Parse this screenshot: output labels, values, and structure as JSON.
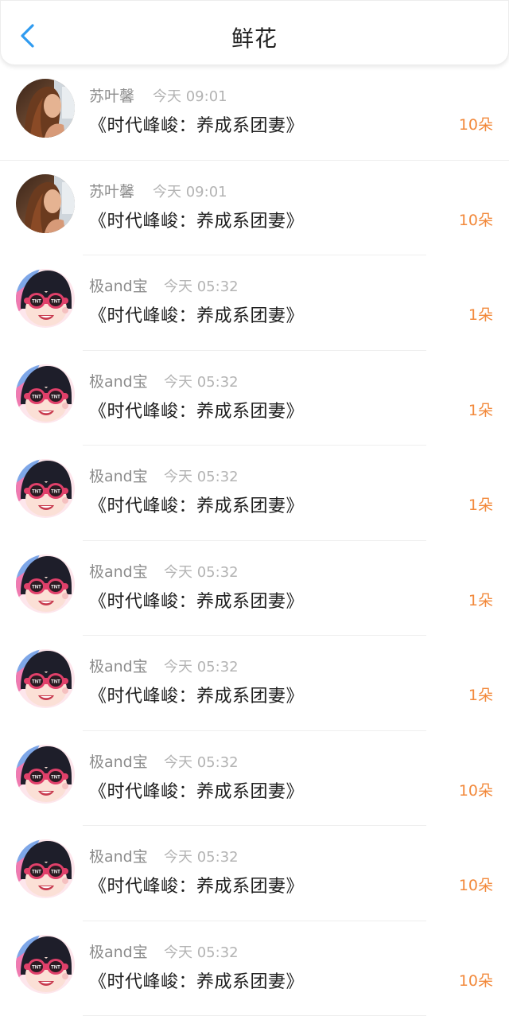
{
  "header": {
    "title": "鲜花",
    "accent_color": "#2f9bf0"
  },
  "flower_color": "#f2893b",
  "records": [
    {
      "user": "苏叶馨",
      "time": "今天 09:01",
      "book": "《时代峰峻：养成系团妻》",
      "count": "10朵",
      "avatar": "photo-avatar"
    },
    {
      "user": "苏叶馨",
      "time": "今天 09:01",
      "book": "《时代峰峻：养成系团妻》",
      "count": "10朵",
      "avatar": "photo-avatar"
    },
    {
      "user": "极and宝",
      "time": "今天 05:32",
      "book": "《时代峰峻：养成系团妻》",
      "count": "1朵",
      "avatar": "cartoon-avatar"
    },
    {
      "user": "极and宝",
      "time": "今天 05:32",
      "book": "《时代峰峻：养成系团妻》",
      "count": "1朵",
      "avatar": "cartoon-avatar"
    },
    {
      "user": "极and宝",
      "time": "今天 05:32",
      "book": "《时代峰峻：养成系团妻》",
      "count": "1朵",
      "avatar": "cartoon-avatar"
    },
    {
      "user": "极and宝",
      "time": "今天 05:32",
      "book": "《时代峰峻：养成系团妻》",
      "count": "1朵",
      "avatar": "cartoon-avatar"
    },
    {
      "user": "极and宝",
      "time": "今天 05:32",
      "book": "《时代峰峻：养成系团妻》",
      "count": "1朵",
      "avatar": "cartoon-avatar"
    },
    {
      "user": "极and宝",
      "time": "今天 05:32",
      "book": "《时代峰峻：养成系团妻》",
      "count": "10朵",
      "avatar": "cartoon-avatar"
    },
    {
      "user": "极and宝",
      "time": "今天 05:32",
      "book": "《时代峰峻：养成系团妻》",
      "count": "10朵",
      "avatar": "cartoon-avatar"
    },
    {
      "user": "极and宝",
      "time": "今天 05:32",
      "book": "《时代峰峻：养成系团妻》",
      "count": "10朵",
      "avatar": "cartoon-avatar"
    }
  ]
}
